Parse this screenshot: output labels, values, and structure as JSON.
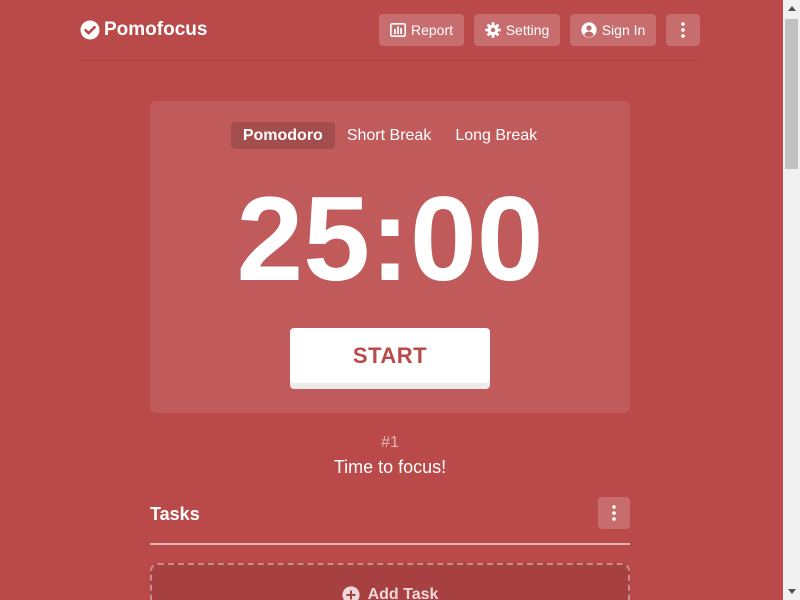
{
  "header": {
    "logo_text": "Pomofocus",
    "report_label": "Report",
    "setting_label": "Setting",
    "signin_label": "Sign In"
  },
  "timer": {
    "tabs": [
      {
        "label": "Pomodoro",
        "active": true
      },
      {
        "label": "Short Break",
        "active": false
      },
      {
        "label": "Long Break",
        "active": false
      }
    ],
    "time": "25:00",
    "start_label": "START"
  },
  "session": {
    "counter": "#1",
    "message": "Time to focus!"
  },
  "tasks": {
    "title": "Tasks",
    "add_label": "Add Task"
  },
  "colors": {
    "background": "#ba4949",
    "button_text": "#ba4949"
  }
}
